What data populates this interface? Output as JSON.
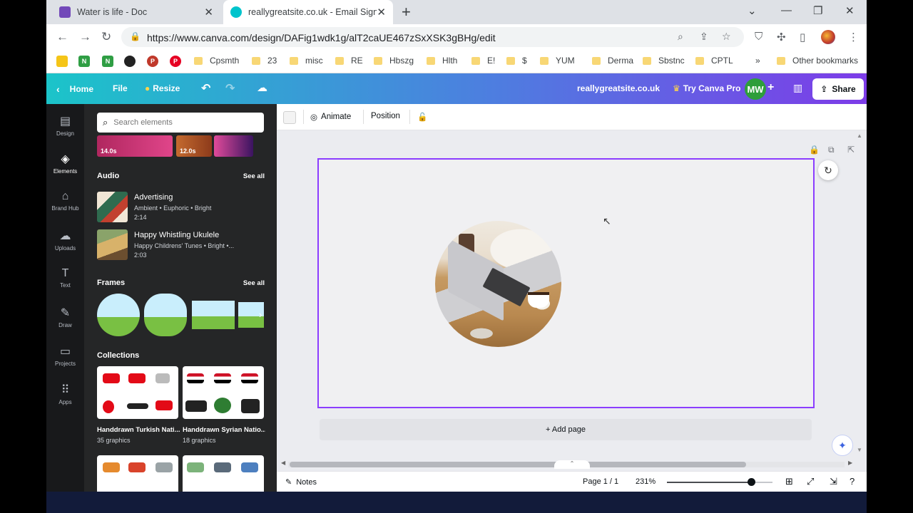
{
  "browser": {
    "tabs": [
      {
        "title": "Water is life - Doc",
        "icon_color": "#7248b9",
        "active": false
      },
      {
        "title": "reallygreatsite.co.uk - Email Signa",
        "icon_color": "#00c4cc",
        "active": true
      }
    ],
    "url": "https://www.canva.com/design/DAFig1wdk1g/alT2caUE467zSxXSK3gBHg/edit",
    "bookmarks": [
      "Cpsmth",
      "23",
      "misc",
      "RE",
      "Hbszg",
      "Hlth",
      "E!",
      "$",
      "YUM",
      "Derma",
      "Sbstnc",
      "CPTL"
    ],
    "other_bookmarks": "Other bookmarks"
  },
  "canva_bar": {
    "home": "Home",
    "file": "File",
    "resize": "Resize",
    "site_name": "reallygreatsite.co.uk",
    "try_pro": "Try Canva Pro",
    "avatar": "MW",
    "share": "Share"
  },
  "rail": [
    {
      "label": "Design",
      "icon": "layout-icon"
    },
    {
      "label": "Elements",
      "icon": "elements-icon",
      "active": true
    },
    {
      "label": "Brand Hub",
      "icon": "brand-hub-icon"
    },
    {
      "label": "Uploads",
      "icon": "upload-cloud-icon"
    },
    {
      "label": "Text",
      "icon": "text-icon"
    },
    {
      "label": "Draw",
      "icon": "draw-icon"
    },
    {
      "label": "Projects",
      "icon": "folder-icon"
    },
    {
      "label": "Apps",
      "icon": "apps-grid-icon"
    }
  ],
  "panel": {
    "search_placeholder": "Search elements",
    "videos": [
      {
        "duration": "14.0s"
      },
      {
        "duration": "12.0s"
      }
    ],
    "audio_heading": "Audio",
    "see_all": "See all",
    "audio": [
      {
        "title": "Advertising",
        "tags": "Ambient • Euphoric • Bright",
        "duration": "2:14"
      },
      {
        "title": "Happy Whistling Ukulele",
        "tags": "Happy Childrens' Tunes • Bright •...",
        "duration": "2:03"
      }
    ],
    "frames_heading": "Frames",
    "collections_heading": "Collections",
    "collections": [
      {
        "name": "Handdrawn Turkish Nati...",
        "count": "35 graphics"
      },
      {
        "name": "Handdrawn Syrian Natio...",
        "count": "18 graphics"
      }
    ]
  },
  "toolbar": {
    "animate": "Animate",
    "position": "Position"
  },
  "editor": {
    "add_page": "+ Add page"
  },
  "status": {
    "notes": "Notes",
    "page": "Page 1 / 1",
    "zoom": "231%",
    "zoom_level": 0.8
  },
  "colors": {
    "canvas_border": "#8b3dff",
    "canva_gradient_start": "#1bc4c9",
    "canva_gradient_end": "#7d3ce8",
    "avatar_bg": "#2e9e3b"
  }
}
